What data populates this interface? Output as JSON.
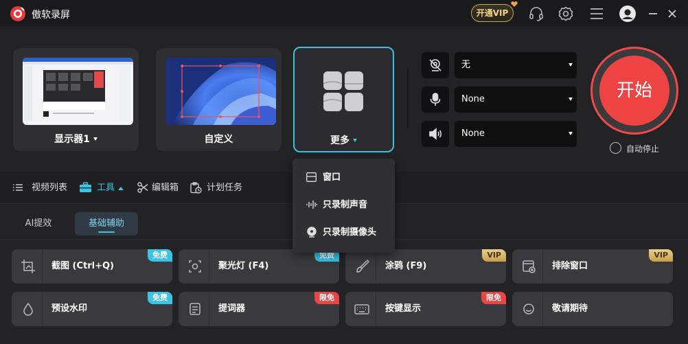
{
  "app": {
    "title": "傲软录屏"
  },
  "titlebar": {
    "vip_label": "开通VIP"
  },
  "sources": {
    "monitor_label": "显示器1",
    "custom_label": "自定义",
    "more_label": "更多"
  },
  "devices": {
    "camera_value": "无",
    "mic_value": "None",
    "speaker_value": "None"
  },
  "start": {
    "label": "开始",
    "auto_stop_label": "自动停止"
  },
  "nav": {
    "video_list": "视频列表",
    "tools": "工具",
    "editor": "编辑箱",
    "schedule": "计划任务"
  },
  "subtabs": {
    "ai": "AI提效",
    "basic": "基础辅助"
  },
  "tools": [
    {
      "label": "截图 (Ctrl+Q)",
      "badge": "免费",
      "badge_type": "free",
      "icon": "crop-icon"
    },
    {
      "label": "聚光灯 (F4)",
      "badge": "免费",
      "badge_type": "free",
      "icon": "spotlight-icon"
    },
    {
      "label": "涂鸦 (F9)",
      "badge": "VIP",
      "badge_type": "vip",
      "icon": "brush-icon"
    },
    {
      "label": "排除窗口",
      "badge": "VIP",
      "badge_type": "vip",
      "icon": "exclude-window-icon"
    },
    {
      "label": "预设水印",
      "badge": "免费",
      "badge_type": "free",
      "icon": "watermark-icon"
    },
    {
      "label": "提词器",
      "badge": "限免",
      "badge_type": "limited",
      "icon": "teleprompter-icon"
    },
    {
      "label": "按键显示",
      "badge": "限免",
      "badge_type": "limited",
      "icon": "keyboard-icon"
    },
    {
      "label": "敬请期待",
      "badge": "",
      "badge_type": "",
      "icon": "smile-icon"
    }
  ],
  "dropdown": {
    "window": "窗口",
    "audio_only": "只录制声音",
    "camera_only": "只录制摄像头"
  },
  "colors": {
    "accent": "#3bc6e6",
    "start": "#ef4444",
    "vip_gold": "#d8b55f"
  }
}
